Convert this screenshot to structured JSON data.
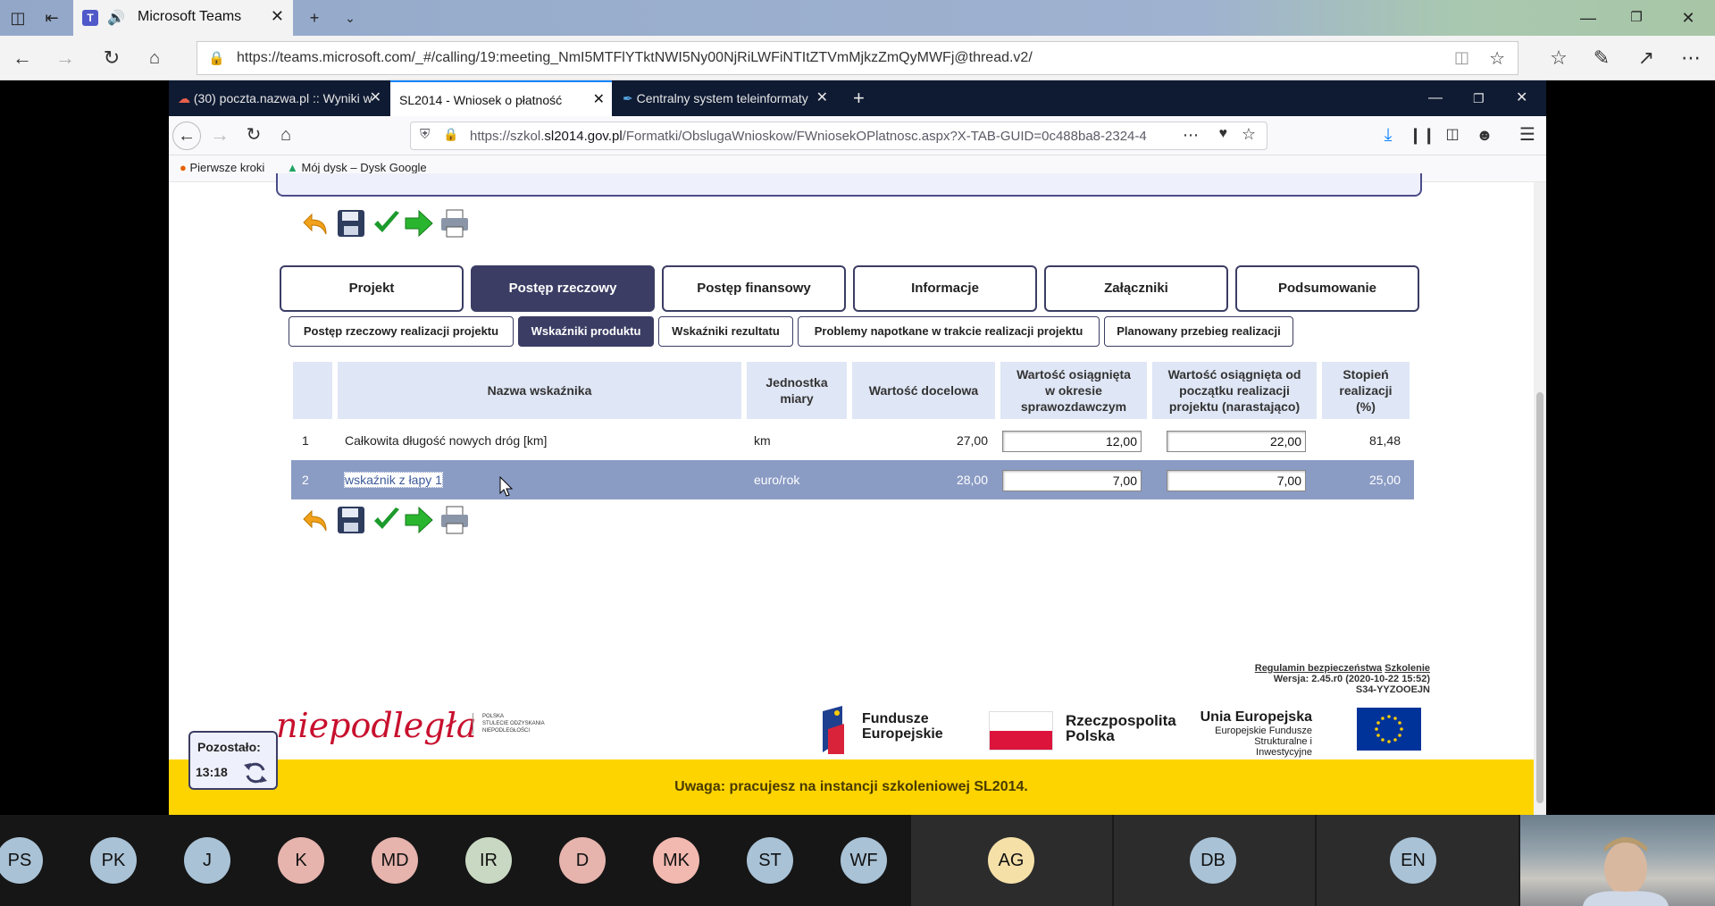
{
  "edge": {
    "tab_title": "Microsoft Teams",
    "url": "https://teams.microsoft.com/_#/calling/19:meeting_NmI5MTFlYTktNWI5Ny00NjRiLWFiNTItZTVmMjkzZmQyMWFj@thread.v2/"
  },
  "ff": {
    "tabs": [
      {
        "label": "(30) poczta.nazwa.pl :: Wyniki w"
      },
      {
        "label": "SL2014 - Wniosek o płatność"
      },
      {
        "label": "Centralny system teleinformaty"
      }
    ],
    "url_prefix": "https://szkol.",
    "url_domain": "sl2014.gov.pl",
    "url_rest": "/Formatki/ObslugaWnioskow/FWniosekOPlatnosc.aspx?X-TAB-GUID=0c488ba8-2324-4",
    "bookmarks": [
      "Pierwsze kroki",
      "Mój dysk – Dysk Google"
    ]
  },
  "main_tabs": [
    "Projekt",
    "Postęp rzeczowy",
    "Postęp finansowy",
    "Informacje",
    "Załączniki",
    "Podsumowanie"
  ],
  "sub_tabs": [
    "Postęp rzeczowy realizacji projektu",
    "Wskaźniki produktu",
    "Wskaźniki rezultatu",
    "Problemy napotkane w trakcie realizacji projektu",
    "Planowany przebieg realizacji"
  ],
  "table": {
    "headers": {
      "name": "Nazwa wskaźnika",
      "unit_1": "Jednostka",
      "unit_2": "miary",
      "target": "Wartość docelowa",
      "period_1": "Wartość osiągnięta",
      "period_2": "w okresie",
      "period_3": "sprawozdawczym",
      "cumul_1": "Wartość osiągnięta od",
      "cumul_2": "początku realizacji",
      "cumul_3": "projektu (narastająco)",
      "deg_1": "Stopień",
      "deg_2": "realizacji",
      "deg_3": "(%)"
    },
    "rows": [
      {
        "no": "1",
        "name": "Całkowita długość nowych dróg [km]",
        "unit": "km",
        "target": "27,00",
        "period": "12,00",
        "cumul": "22,00",
        "degree": "81,48"
      },
      {
        "no": "2",
        "name": "wskaźnik z łapy 1",
        "unit": "euro/rok",
        "target": "28,00",
        "period": "7,00",
        "cumul": "7,00",
        "degree": "25,00"
      }
    ]
  },
  "footer": {
    "link1": "Regulamin bezpieczeństwa",
    "link2": "Szkolenie",
    "version": "Wersja:  2.45.r0 (2020-10-22 15:52)",
    "code": "S34-YYZOOEJN",
    "niep": "niepodległa",
    "niep_small_1": "POLSKA",
    "niep_small_2": "STULECIE ODZYSKANIA",
    "niep_small_3": "NIEPODLEGŁOŚCI",
    "fe_1": "Fundusze",
    "fe_2": "Europejskie",
    "rp_1": "Rzeczpospolita",
    "rp_2": "Polska",
    "ue_1": "Unia Europejska",
    "ue_2": "Europejskie Fundusze",
    "ue_3": "Strukturalne i Inwestycyjne",
    "warning": "Uwaga: pracujesz na instancji szkoleniowej SL2014."
  },
  "timer": {
    "label": "Pozostało:",
    "time": "13:18"
  },
  "participants": [
    "PS",
    "PK",
    "J",
    "K",
    "MD",
    "IR",
    "D",
    "MK",
    "ST",
    "WF",
    "AG",
    "DB",
    "EN"
  ],
  "colors": {
    "accent": "#3b3d64",
    "warning": "#fdd400",
    "selected_row": "#8a9bc4"
  }
}
